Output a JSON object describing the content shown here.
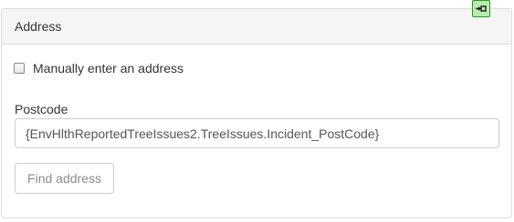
{
  "panel": {
    "title": "Address",
    "corner_icon": "plugin-connector-icon",
    "corner_icon_color": "#b7eeb0"
  },
  "manual_entry": {
    "label": "Manually enter an address",
    "checked": false
  },
  "postcode": {
    "label": "Postcode",
    "value": "{EnvHlthReportedTreeIssues2.TreeIssues.Incident_PostCode}"
  },
  "find_button": {
    "label": "Find address"
  }
}
